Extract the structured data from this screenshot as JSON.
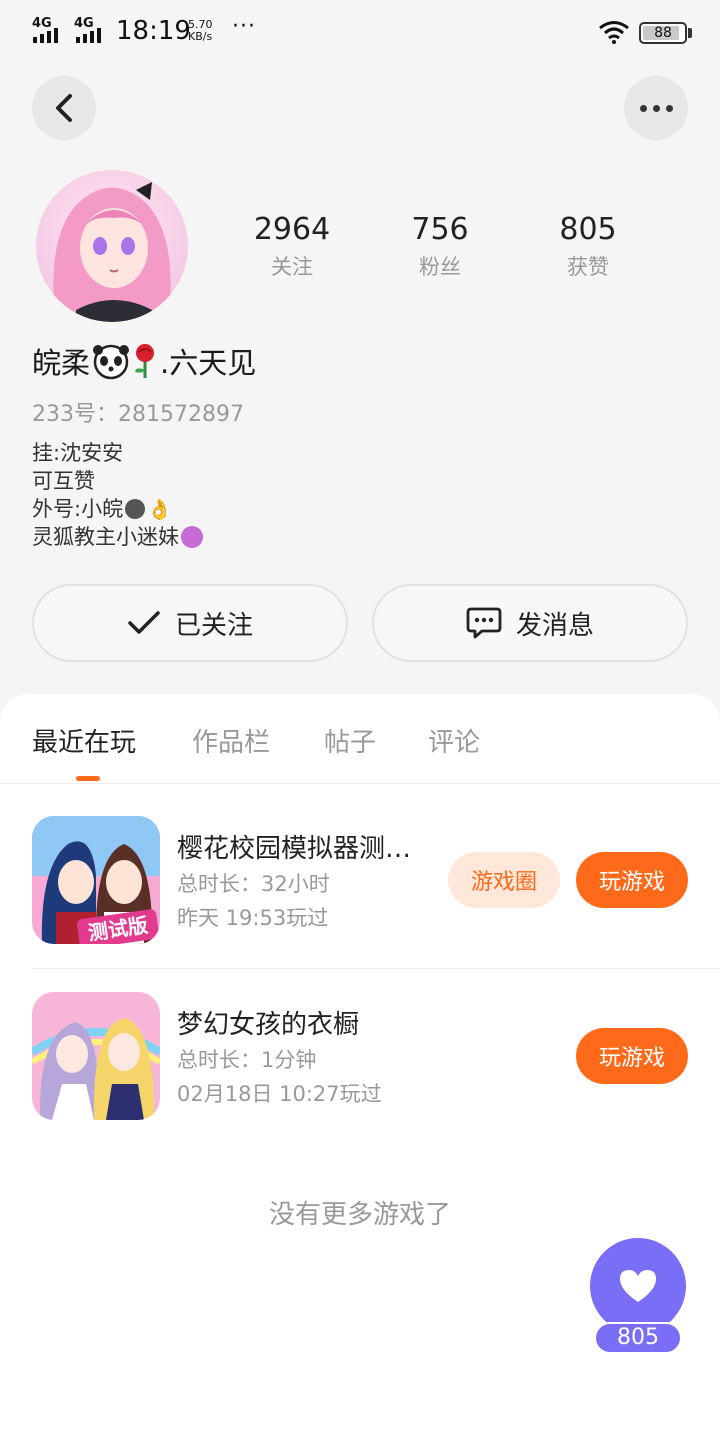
{
  "status_bar": {
    "network1": "4G",
    "network2": "4G",
    "time": "18:19",
    "speed_value": "5.70",
    "speed_unit": "KB/s",
    "more_dots": "···",
    "battery": "88"
  },
  "profile": {
    "stats": [
      {
        "value": "2964",
        "label": "关注"
      },
      {
        "value": "756",
        "label": "粉丝"
      },
      {
        "value": "805",
        "label": "获赞"
      }
    ],
    "nickname_prefix": "皖柔",
    "nickname_suffix": ".六天见",
    "uid": "233号：281572897",
    "bio_lines": [
      "挂:沈安安",
      "可互赞",
      "外号:小皖",
      "灵狐教主小迷妹"
    ]
  },
  "actions": {
    "follow_label": "已关注",
    "message_label": "发消息"
  },
  "tabs": [
    "最近在玩",
    "作品栏",
    "帖子",
    "评论"
  ],
  "games": [
    {
      "title": "樱花校园模拟器测…",
      "duration": "总时长：32小时",
      "last_played": "昨天 19:53玩过",
      "circle_label": "游戏圈",
      "play_label": "玩游戏",
      "badge": "测试版"
    },
    {
      "title": "梦幻女孩的衣橱",
      "duration": "总时长：1分钟",
      "last_played": "02月18日 10:27玩过",
      "play_label": "玩游戏"
    }
  ],
  "no_more_text": "没有更多游戏了",
  "like_count": "805",
  "colors": {
    "accent": "#ff6a1a",
    "like_fab": "#7b6ef6"
  }
}
